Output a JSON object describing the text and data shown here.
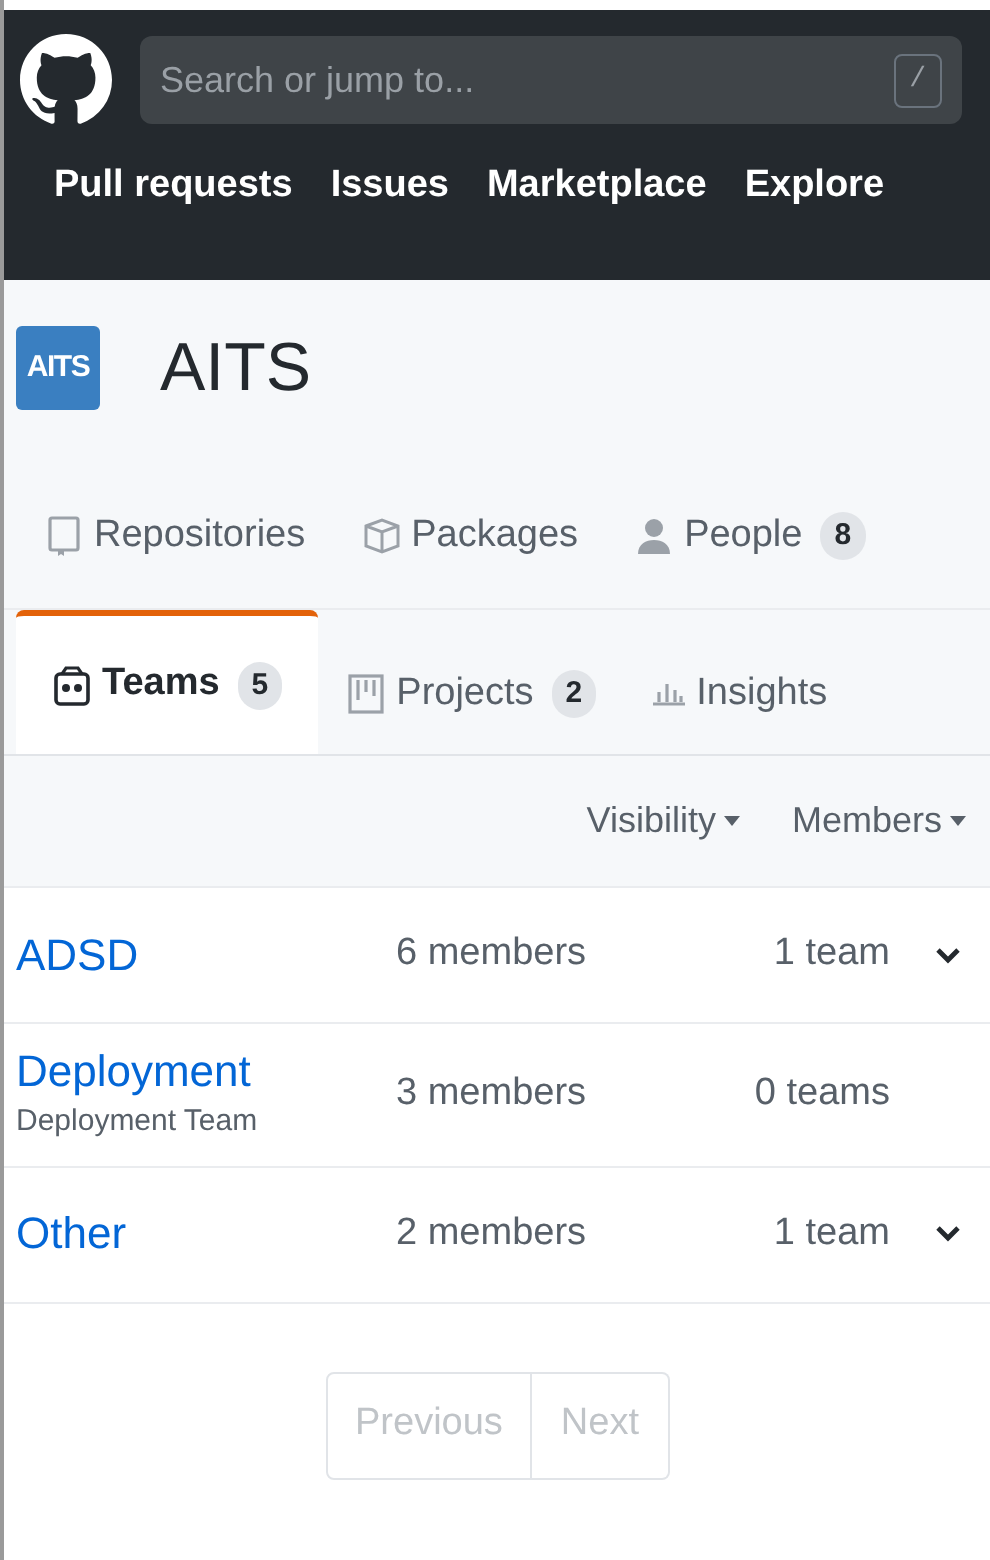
{
  "header": {
    "search": {
      "placeholder": "Search or jump to...",
      "shortcut": "/"
    },
    "nav": [
      "Pull requests",
      "Issues",
      "Marketplace",
      "Explore"
    ]
  },
  "org": {
    "avatar_text": "AITS",
    "name": "AITS"
  },
  "tabs": [
    {
      "label": "Repositories",
      "kind": "repo",
      "selected": false
    },
    {
      "label": "Packages",
      "kind": "package",
      "selected": false
    },
    {
      "label": "People",
      "kind": "person",
      "counter": "8",
      "selected": false
    },
    {
      "label": "Teams",
      "kind": "team",
      "counter": "5",
      "selected": true
    },
    {
      "label": "Projects",
      "kind": "project",
      "counter": "2",
      "selected": false
    },
    {
      "label": "Insights",
      "kind": "graph",
      "selected": false
    }
  ],
  "filters": [
    "Visibility",
    "Members"
  ],
  "teams": [
    {
      "name": "ADSD",
      "members": "6 members",
      "child_teams": "1 team",
      "expandable": true
    },
    {
      "name": "Deployment",
      "description": "Deployment Team",
      "members": "3 members",
      "child_teams": "0 teams",
      "expandable": false
    },
    {
      "name": "Other",
      "members": "2 members",
      "child_teams": "1 team",
      "expandable": true
    }
  ],
  "pagination": [
    {
      "label": "Previous",
      "disabled": true
    },
    {
      "label": "Next",
      "disabled": true
    }
  ]
}
